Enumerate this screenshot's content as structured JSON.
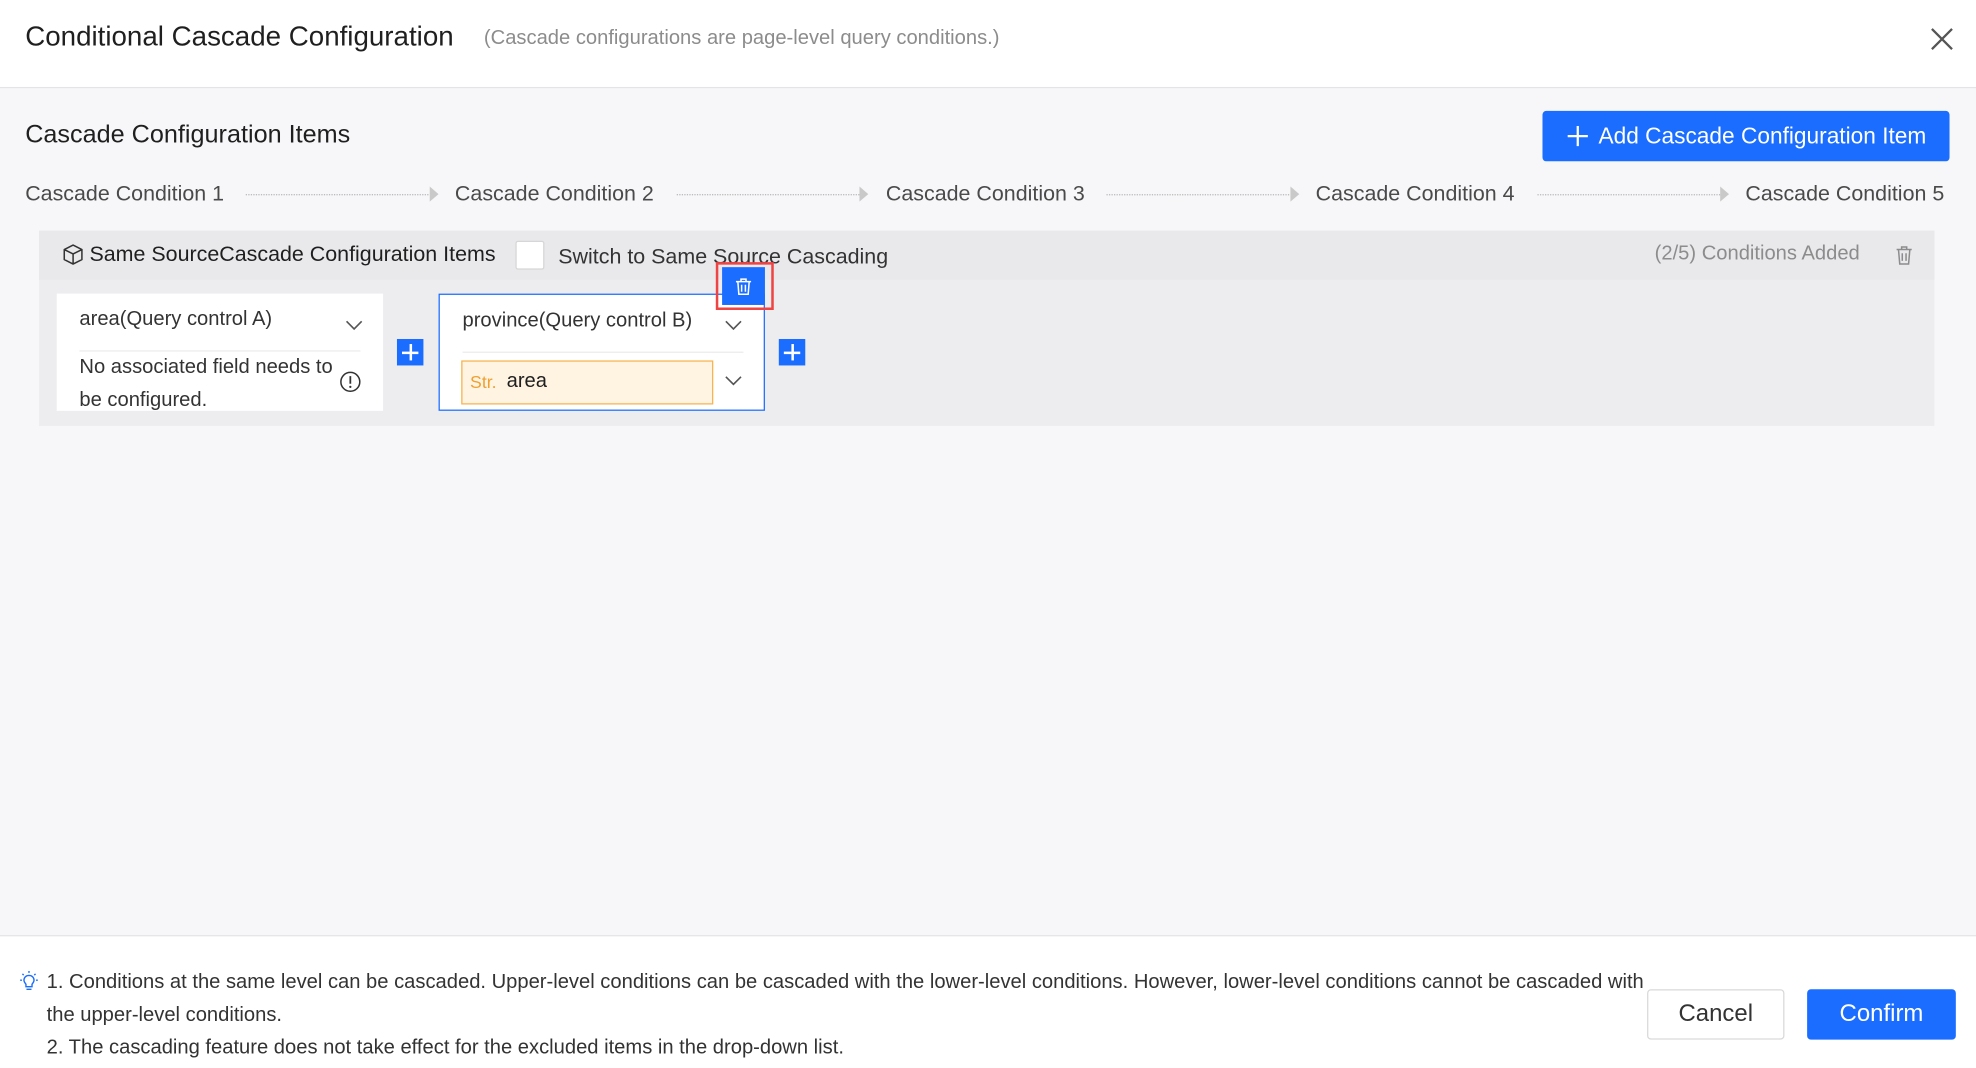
{
  "dialog": {
    "title": "Conditional Cascade Configuration",
    "subtitle": "(Cascade configurations are page-level query conditions.)",
    "close_icon": "close-icon"
  },
  "section": {
    "title": "Cascade Configuration Items",
    "add_button": "Add Cascade Configuration Item"
  },
  "steps": [
    "Cascade Condition 1",
    "Cascade Condition 2",
    "Cascade Condition 3",
    "Cascade Condition 4",
    "Cascade Condition 5"
  ],
  "config_item": {
    "title": "Same SourceCascade Configuration Items",
    "switch_label": "Switch to Same Source Cascading",
    "count": "(2/5) Conditions Added",
    "conditions": [
      {
        "control": "area(Query control A)",
        "note": "No associated field needs to be configured."
      },
      {
        "control": "province(Query control B)",
        "field_type": "Str.",
        "field_name": "area"
      }
    ]
  },
  "footer": {
    "note_1": "1. Conditions at the same level can be cascaded. Upper-level conditions can be cascaded with the lower-level conditions. However, lower-level conditions cannot be cascaded with the upper-level conditions.",
    "note_2": "2. The cascading feature does not take effect for the excluded items in the drop-down list.",
    "cancel": "Cancel",
    "confirm": "Confirm"
  },
  "colors": {
    "primary": "#1a6dff",
    "highlight": "#ef4444",
    "field_bg": "#fff3e2",
    "field_border": "#f7b350"
  }
}
